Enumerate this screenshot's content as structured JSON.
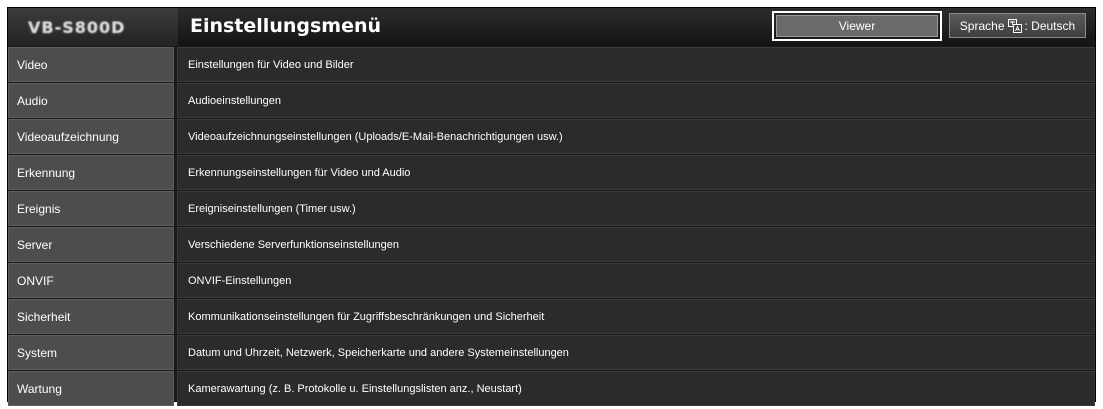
{
  "header": {
    "logo": "VB-S800D",
    "title": "Einstellungsmenü",
    "viewer_label": "Viewer",
    "language_label_prefix": "Sprache",
    "language_value": ": Deutsch"
  },
  "menu": [
    {
      "label": "Video",
      "description": "Einstellungen für Video und Bilder"
    },
    {
      "label": "Audio",
      "description": "Audioeinstellungen"
    },
    {
      "label": "Videoaufzeichnung",
      "description": "Videoaufzeichnungseinstellungen (Uploads/E-Mail-Benachrichtigungen usw.)"
    },
    {
      "label": "Erkennung",
      "description": "Erkennungseinstellungen für Video und Audio"
    },
    {
      "label": "Ereignis",
      "description": "Ereigniseinstellungen (Timer usw.)"
    },
    {
      "label": "Server",
      "description": "Verschiedene Serverfunktionseinstellungen"
    },
    {
      "label": "ONVIF",
      "description": "ONVIF-Einstellungen"
    },
    {
      "label": "Sicherheit",
      "description": "Kommunikationseinstellungen für Zugriffsbeschränkungen und Sicherheit"
    },
    {
      "label": "System",
      "description": "Datum und Uhrzeit, Netzwerk, Speicherkarte und andere Systemeinstellungen"
    },
    {
      "label": "Wartung",
      "description": "Kamerawartung (z. B. Protokolle u. Einstellungslisten anz., Neustart)"
    }
  ]
}
